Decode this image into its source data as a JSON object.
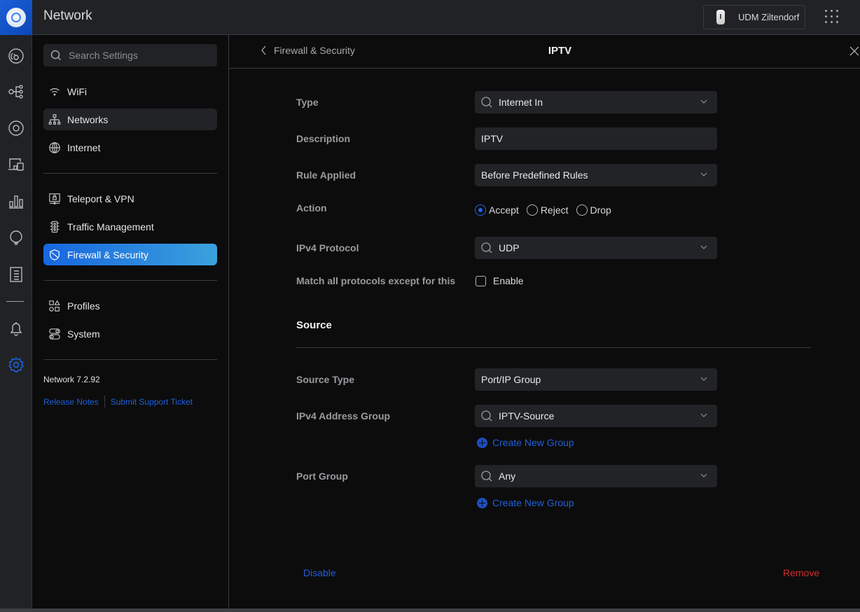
{
  "header": {
    "app_title": "Network",
    "device_name": "UDM Ziltendorf",
    "logo_icon": "ubiquiti-logo-icon",
    "apps_icon": "apps-grid-icon"
  },
  "rail": {
    "items": [
      {
        "name": "dashboard",
        "icon": "dashboard-gauge-icon"
      },
      {
        "name": "topology",
        "icon": "topology-icon"
      },
      {
        "name": "unifi-devices",
        "icon": "device-disc-icon"
      },
      {
        "name": "client-devices",
        "icon": "client-devices-icon"
      },
      {
        "name": "statistics",
        "icon": "bar-chart-icon"
      },
      {
        "name": "insights",
        "icon": "lightbulb-icon"
      },
      {
        "name": "system-log",
        "icon": "notebook-icon"
      },
      {
        "name": "alerts",
        "icon": "bell-icon"
      },
      {
        "name": "settings",
        "icon": "gear-icon",
        "active": true
      }
    ]
  },
  "sidebar": {
    "search_placeholder": "Search Settings",
    "groups": [
      [
        {
          "label": "WiFi",
          "icon": "wifi-icon"
        },
        {
          "label": "Networks",
          "icon": "network-tree-icon",
          "hover": true
        },
        {
          "label": "Internet",
          "icon": "globe-icon"
        }
      ],
      [
        {
          "label": "Teleport & VPN",
          "icon": "vpn-lock-icon"
        },
        {
          "label": "Traffic Management",
          "icon": "traffic-light-icon"
        },
        {
          "label": "Firewall & Security",
          "icon": "shield-icon",
          "active": true
        }
      ],
      [
        {
          "label": "Profiles",
          "icon": "shapes-icon"
        },
        {
          "label": "System",
          "icon": "system-toggle-icon"
        }
      ]
    ],
    "version": "Network 7.2.92",
    "links": {
      "release_notes": "Release Notes",
      "support": "Submit Support Ticket"
    }
  },
  "panel": {
    "back_label": "Firewall & Security",
    "title": "IPTV",
    "fields": {
      "type": {
        "label": "Type",
        "value": "Internet In"
      },
      "description": {
        "label": "Description",
        "value": "IPTV"
      },
      "rule_applied": {
        "label": "Rule Applied",
        "value": "Before Predefined Rules"
      },
      "action": {
        "label": "Action",
        "options": [
          "Accept",
          "Reject",
          "Drop"
        ],
        "selected": "Accept"
      },
      "ipv4_protocol": {
        "label": "IPv4 Protocol",
        "value": "UDP"
      },
      "match_all": {
        "label": "Match all protocols except for this",
        "checkbox_label": "Enable",
        "checked": false
      }
    },
    "source": {
      "title": "Source",
      "source_type": {
        "label": "Source Type",
        "value": "Port/IP Group"
      },
      "ipv4_address_group": {
        "label": "IPv4 Address Group",
        "value": "IPTV-Source",
        "create_label": "Create New Group"
      },
      "port_group": {
        "label": "Port Group",
        "value": "Any",
        "create_label": "Create New Group"
      }
    },
    "footer": {
      "disable_label": "Disable",
      "remove_label": "Remove"
    }
  },
  "colors": {
    "accent": "#1d6af0",
    "danger": "#d12c2c",
    "link": "#1f5fd8"
  }
}
